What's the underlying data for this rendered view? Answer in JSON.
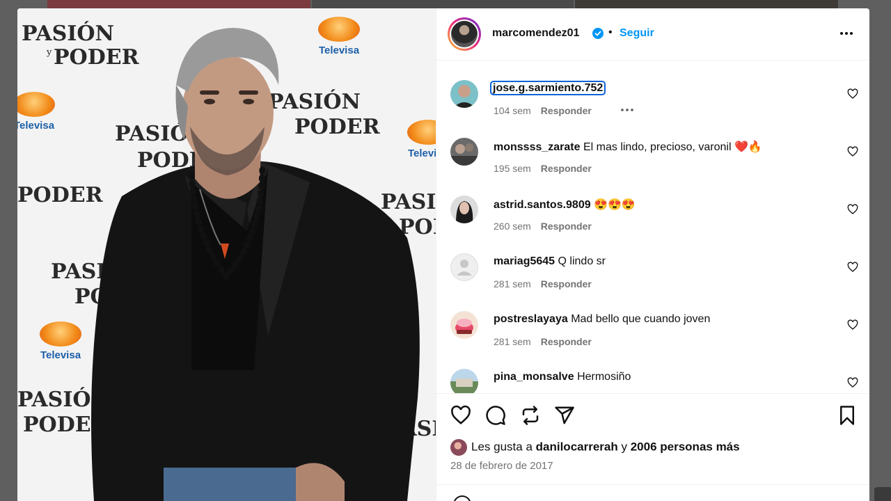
{
  "post": {
    "username": "marcomendez01",
    "separator": "•",
    "follow_label": "Seguir",
    "photo_logos": {
      "show_title_top": "PASIÓN",
      "show_title_bottom": "PODER",
      "show_connector": "y",
      "network": "Televisa"
    }
  },
  "comments": [
    {
      "username": "jose.g.sarmiento.752",
      "text": "",
      "time": "104 sem",
      "reply": "Responder"
    },
    {
      "username": "monssss_zarate",
      "text": "El mas lindo, precioso, varonil ❤️🔥",
      "time": "195 sem",
      "reply": "Responder"
    },
    {
      "username": "astrid.santos.9809",
      "text": "😍😍😍",
      "time": "260 sem",
      "reply": "Responder"
    },
    {
      "username": "mariag5645",
      "text": "Q lindo sr",
      "time": "281 sem",
      "reply": "Responder"
    },
    {
      "username": "postreslayaya",
      "text": "Mad bello que cuando joven",
      "time": "281 sem",
      "reply": "Responder"
    },
    {
      "username": "pina_monsalve",
      "text": "Hermosiño",
      "time": "",
      "reply": ""
    }
  ],
  "likes": {
    "prefix": "Les gusta a",
    "user": "danilocarrerah",
    "connector": "y",
    "others": "2006 personas más"
  },
  "date": "28 de febrero de 2017",
  "icons": [
    "verified-badge-icon",
    "more-options-icon",
    "heart-icon",
    "comment-icon",
    "repost-icon",
    "share-icon",
    "bookmark-icon"
  ],
  "colors": {
    "link": "#0095f6",
    "text": "#111111",
    "meta": "#737373",
    "focus": "#0b62d6"
  }
}
